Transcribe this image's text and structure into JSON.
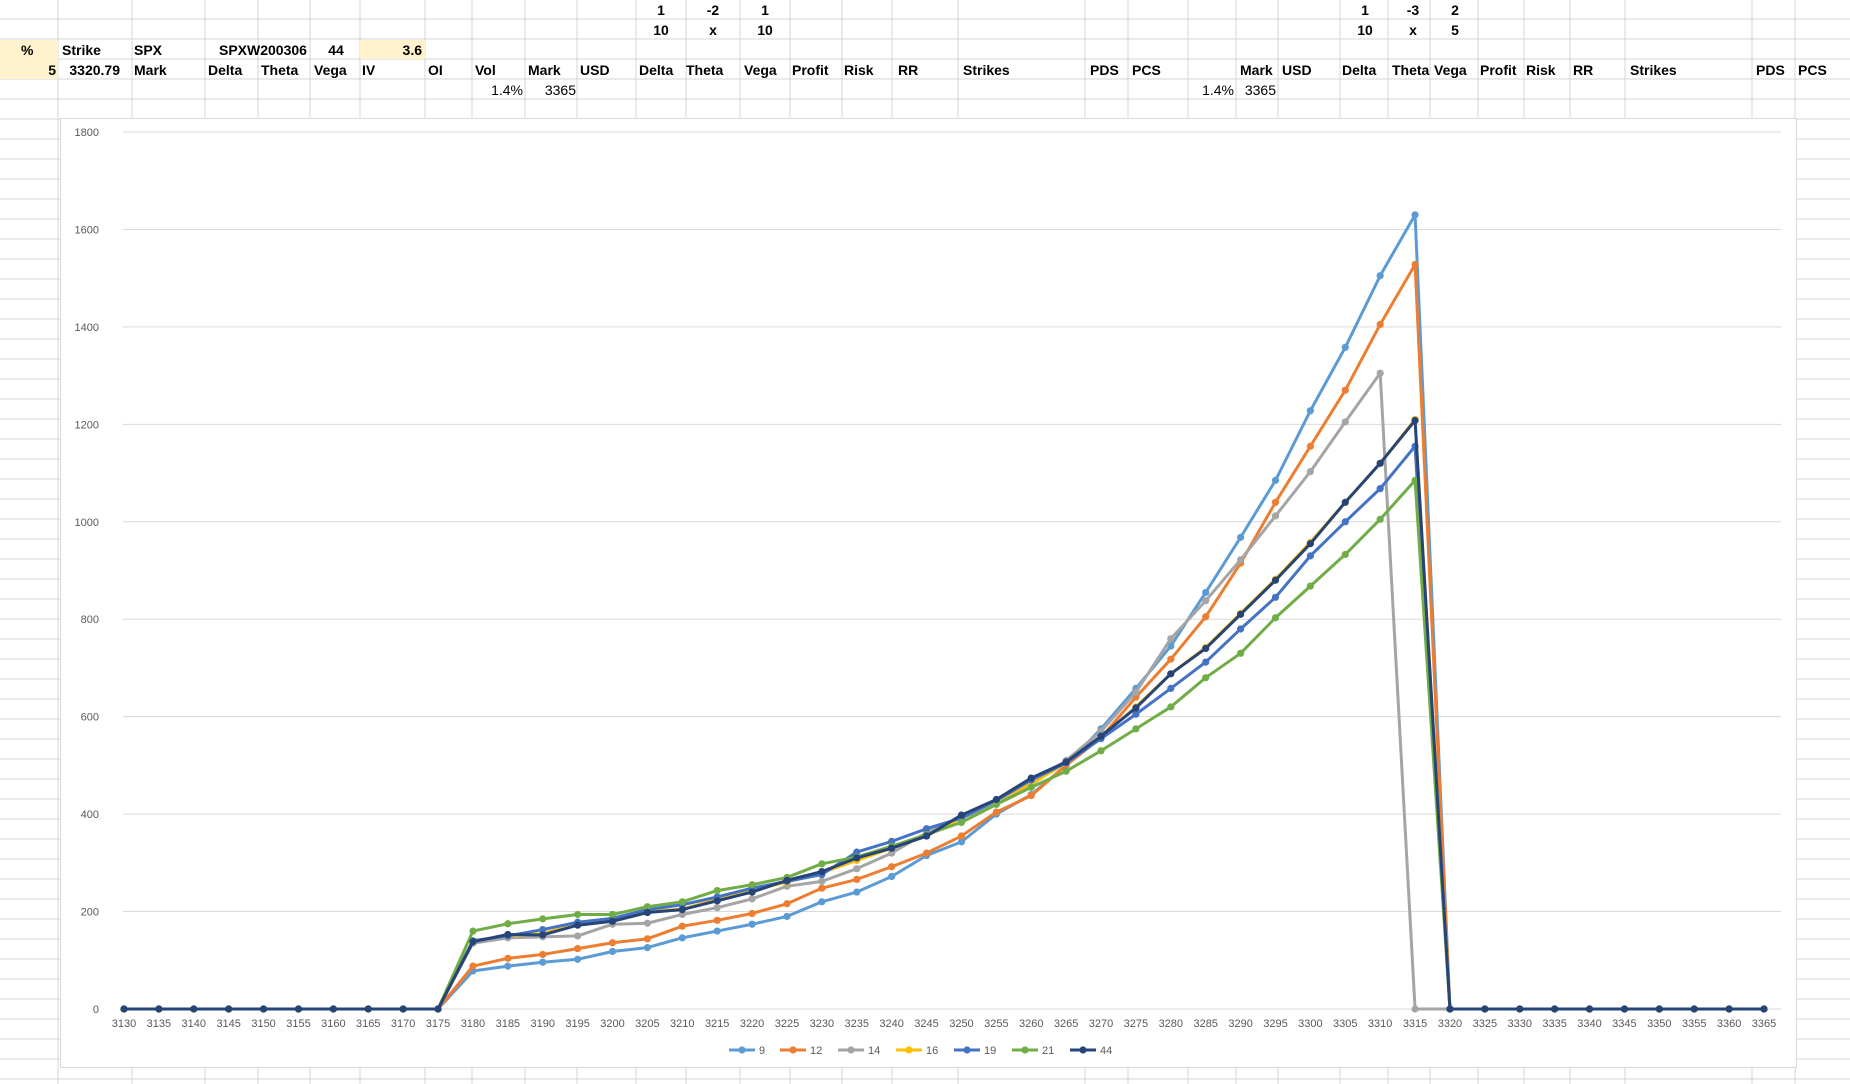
{
  "sheet": {
    "row1": {
      "left_1": "1",
      "left_neg": "-2",
      "left_2": "1",
      "right_1": "1",
      "right_neg": "-3",
      "right_2": "2"
    },
    "row2": {
      "left_a": "10",
      "left_x": "x",
      "left_b": "10",
      "right_a": "10",
      "right_x": "x",
      "right_b": "5"
    },
    "row3": {
      "pct": "%",
      "strike": "Strike",
      "spx": "SPX",
      "symbol": "SPXW200306",
      "dte": "44",
      "value": "3.6"
    },
    "row4": {
      "pct_val": "5",
      "spot": "3320.79",
      "mark": "Mark",
      "delta": "Delta",
      "theta": "Theta",
      "vega": "Vega",
      "iv": "IV",
      "oi": "OI",
      "vol": "Vol",
      "l_mark": "Mark",
      "l_usd": "USD",
      "l_delta": "Delta",
      "l_theta": "Theta",
      "l_vega": "Vega",
      "l_profit": "Profit",
      "l_risk": "Risk",
      "l_rr": "RR",
      "l_strikes": "Strikes",
      "l_pds": "PDS",
      "l_pcs": "PCS",
      "r_mark": "Mark",
      "r_usd": "USD",
      "r_delta": "Delta",
      "r_theta": "Theta",
      "r_vega": "Vega",
      "r_profit": "Profit",
      "r_risk": "Risk",
      "r_rr": "RR",
      "r_strikes": "Strikes",
      "r_pds": "PDS",
      "r_pcs": "PCS"
    },
    "row5": {
      "l_pct": "1.4%",
      "l_mark_val": "3365",
      "r_pct": "1.4%",
      "r_mark_val": "3365"
    }
  },
  "chart_data": {
    "type": "line",
    "title": "",
    "xlabel": "",
    "ylabel": "",
    "ylim": [
      0,
      1800
    ],
    "yticks": [
      0,
      200,
      400,
      600,
      800,
      1000,
      1200,
      1400,
      1600,
      1800
    ],
    "grid": true,
    "legend_position": "bottom",
    "categories": [
      "3130",
      "3135",
      "3140",
      "3145",
      "3150",
      "3155",
      "3160",
      "3165",
      "3170",
      "3175",
      "3180",
      "3185",
      "3190",
      "3195",
      "3200",
      "3205",
      "3210",
      "3215",
      "3220",
      "3225",
      "3230",
      "3235",
      "3240",
      "3245",
      "3250",
      "3255",
      "3260",
      "3265",
      "3270",
      "3275",
      "3280",
      "3285",
      "3290",
      "3295",
      "3300",
      "3305",
      "3310",
      "3315",
      "3320",
      "3325",
      "3330",
      "3335",
      "3340",
      "3345",
      "3350",
      "3355",
      "3360",
      "3365"
    ],
    "series": [
      {
        "name": "9",
        "color": "#5b9bd5",
        "values": [
          0,
          0,
          0,
          0,
          0,
          0,
          0,
          0,
          0,
          0,
          78,
          88,
          96,
          102,
          118,
          126,
          146,
          160,
          174,
          190,
          220,
          240,
          272,
          315,
          343,
          400,
          440,
          500,
          575,
          658,
          745,
          855,
          968,
          1085,
          1228,
          1358,
          1505,
          1630,
          0,
          0,
          0,
          0,
          0,
          0,
          0,
          0,
          0,
          0
        ]
      },
      {
        "name": "12",
        "color": "#ed7d31",
        "values": [
          0,
          0,
          0,
          0,
          0,
          0,
          0,
          0,
          0,
          0,
          88,
          104,
          112,
          124,
          136,
          144,
          170,
          182,
          196,
          216,
          248,
          266,
          292,
          320,
          355,
          404,
          438,
          500,
          557,
          640,
          718,
          805,
          915,
          1040,
          1155,
          1270,
          1405,
          1528,
          0,
          0,
          0,
          0,
          0,
          0,
          0,
          0,
          0,
          0
        ]
      },
      {
        "name": "14",
        "color": "#a5a5a5",
        "values": [
          0,
          0,
          0,
          0,
          0,
          0,
          0,
          0,
          0,
          0,
          135,
          146,
          148,
          150,
          174,
          176,
          194,
          208,
          226,
          252,
          262,
          288,
          320,
          362,
          392,
          420,
          460,
          510,
          570,
          650,
          760,
          838,
          922,
          1012,
          1103,
          1205,
          1305,
          0,
          0,
          0,
          0,
          0,
          0,
          0,
          0,
          0,
          0,
          0
        ]
      },
      {
        "name": "16",
        "color": "#ffc000",
        "values": [
          0,
          0,
          0,
          0,
          0,
          0,
          0,
          0,
          0,
          0,
          140,
          150,
          155,
          175,
          185,
          200,
          205,
          225,
          245,
          260,
          280,
          305,
          330,
          355,
          392,
          428,
          462,
          505,
          558,
          620,
          688,
          742,
          812,
          882,
          958,
          1040,
          1120,
          1210,
          0,
          0,
          0,
          0,
          0,
          0,
          0,
          0,
          0,
          0
        ]
      },
      {
        "name": "19",
        "color": "#4472c4",
        "values": [
          0,
          0,
          0,
          0,
          0,
          0,
          0,
          0,
          0,
          0,
          140,
          150,
          163,
          178,
          186,
          204,
          214,
          230,
          248,
          262,
          276,
          322,
          344,
          370,
          392,
          428,
          470,
          505,
          555,
          605,
          658,
          712,
          780,
          845,
          930,
          1000,
          1068,
          1155,
          0,
          0,
          0,
          0,
          0,
          0,
          0,
          0,
          0,
          0
        ]
      },
      {
        "name": "21",
        "color": "#70ad47",
        "values": [
          0,
          0,
          0,
          0,
          0,
          0,
          0,
          0,
          0,
          0,
          160,
          175,
          185,
          194,
          194,
          210,
          220,
          243,
          255,
          270,
          298,
          312,
          334,
          358,
          383,
          420,
          455,
          488,
          530,
          575,
          620,
          680,
          730,
          803,
          868,
          933,
          1005,
          1085,
          0,
          0,
          0,
          0,
          0,
          0,
          0,
          0,
          0,
          0
        ]
      },
      {
        "name": "44",
        "color": "#264478",
        "values": [
          0,
          0,
          0,
          0,
          0,
          0,
          0,
          0,
          0,
          0,
          138,
          153,
          152,
          172,
          180,
          198,
          204,
          222,
          240,
          264,
          282,
          310,
          330,
          355,
          398,
          430,
          474,
          507,
          560,
          618,
          688,
          740,
          810,
          880,
          955,
          1040,
          1120,
          1208,
          0,
          0,
          0,
          0,
          0,
          0,
          0,
          0,
          0,
          0
        ]
      }
    ]
  }
}
